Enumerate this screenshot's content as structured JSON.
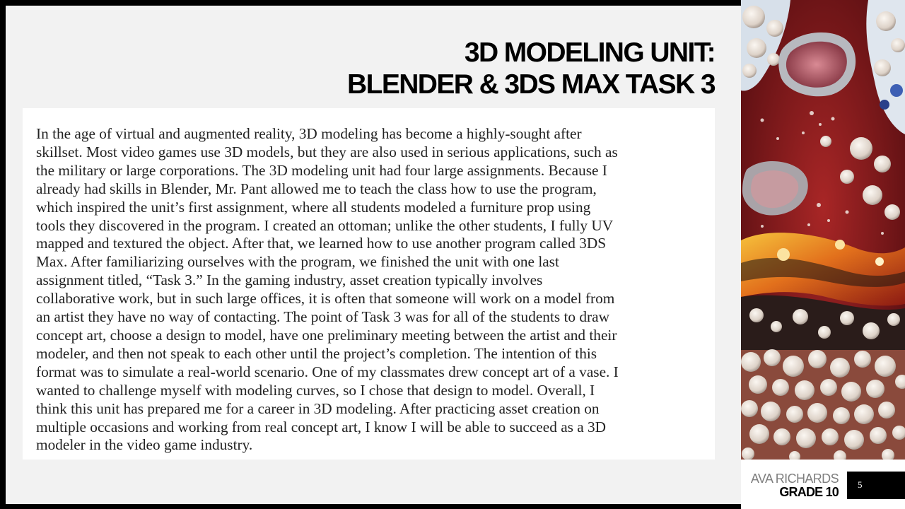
{
  "slide": {
    "title_line1": "3D MODELING UNIT:",
    "title_line2": "BLENDER & 3DS MAX TASK 3",
    "body": "In the age of virtual and augmented reality, 3D modeling has become a highly-sought after\nskillset. Most video games use 3D models, but they are also used in serious applications, such as\nthe military or large corporations. The 3D modeling unit had four large assignments. Because I\nalready had skills in Blender, Mr. Pant allowed me to teach the class how to use the program,\nwhich inspired the unit’s first assignment, where all students modeled a furniture prop using\ntools they discovered in the program. I created an ottoman; unlike the other students, I fully UV\nmapped and textured the object. After that, we learned how to use another program called 3DS\nMax. After familiarizing ourselves with the program, we finished the unit with one last\nassignment titled, “Task 3.” In the gaming industry, asset creation typically involves\ncollaborative work, but in such large offices, it is often that someone will work on a model from\nan artist they have no way of contacting. The point of Task 3 was for all of the students to draw\nconcept art, choose a design to model, have one preliminary meeting between the artist and their\nmodeler, and then not speak to each other until the project’s completion. The intention of this\nformat was to simulate a real-world scenario. One of my classmates drew concept art of a vase. I\nwanted to challenge myself with modeling curves, so I chose that design to model. Overall, I\nthink this unit has prepared me for a career in 3D modeling. After practicing asset creation on\nmultiple occasions and working from real concept art, I know I will be able to succeed as a 3D\nmodeler in the video game industry."
  },
  "footer": {
    "name": "AVA RICHARDS",
    "grade": "GRADE 10",
    "page_number": "5"
  },
  "decoration": {
    "art_image": "abstract-fluid-paint-art",
    "colors": {
      "slide_background": "#f2f2f2",
      "frame": "#000000",
      "text_box": "#ffffff",
      "art_red": "#8e1c1c",
      "art_orange": "#e2701c",
      "art_cream": "#ece4dc",
      "footer_name": "#7f7f7f"
    }
  }
}
